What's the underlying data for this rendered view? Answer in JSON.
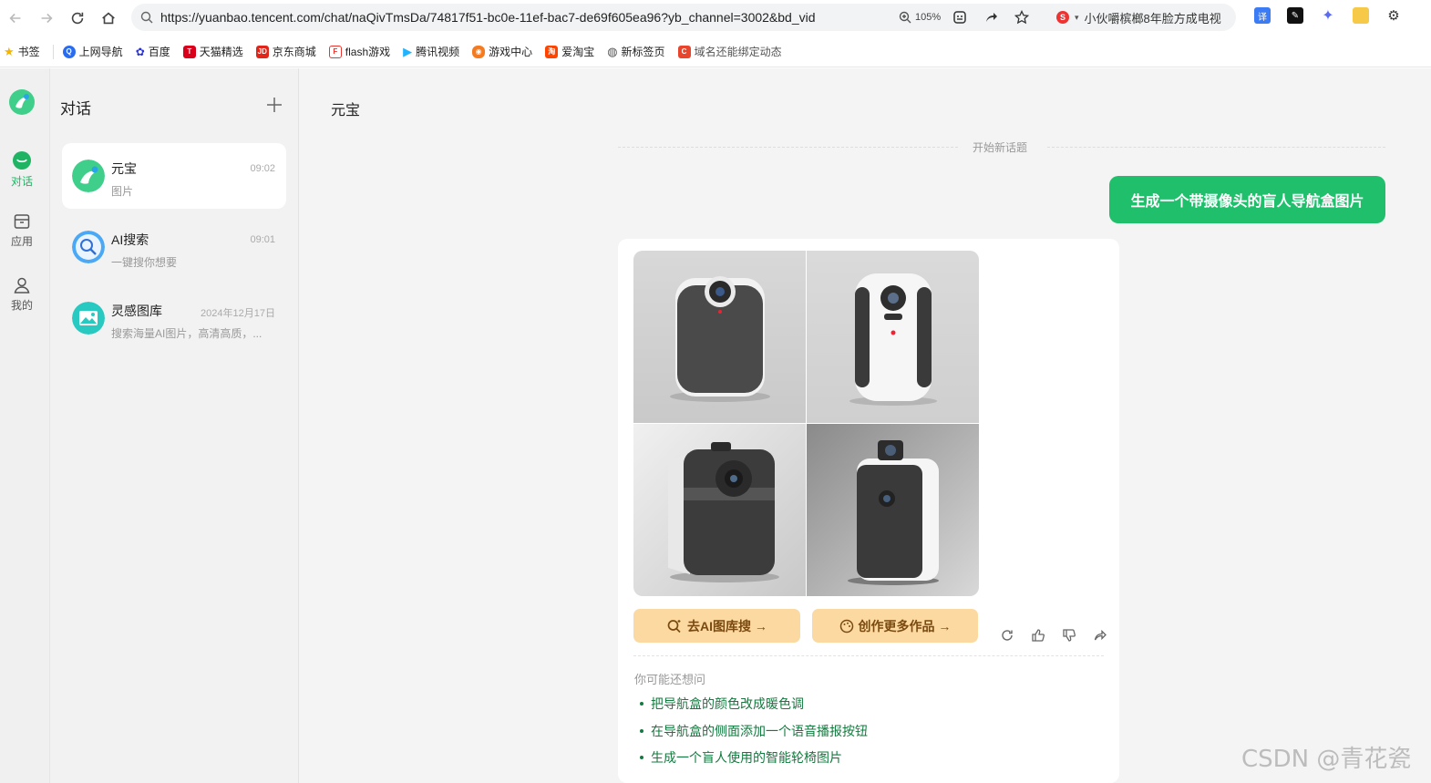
{
  "browser": {
    "url": "https://yuanbao.tencent.com/chat/naQivTmsDa/74817f51-bc0e-11ef-bac7-de69f605ea96?yb_channel=3002&bd_vid",
    "zoom": "105%",
    "search_suggestion": "小伙嚼槟榔8年脸方成电视"
  },
  "bookmarks": [
    {
      "label": "书签",
      "icon": "star-icon",
      "color": "#f5b400"
    },
    {
      "label": "上网导航",
      "icon": "q-icon",
      "color": "#2a6cf0"
    },
    {
      "label": "百度",
      "icon": "baidu-paw-icon",
      "color": "#2932e1"
    },
    {
      "label": "天猫精选",
      "icon": "tmall-icon",
      "color": "#d8001b"
    },
    {
      "label": "京东商城",
      "icon": "jd-icon",
      "color": "#e1251b"
    },
    {
      "label": "flash游戏",
      "icon": "flash-icon",
      "color": "#e8352e"
    },
    {
      "label": "腾讯视频",
      "icon": "tencent-video-icon",
      "color": "#1fb4ff"
    },
    {
      "label": "游戏中心",
      "icon": "gamepad-icon",
      "color": "#f57b20"
    },
    {
      "label": "爱淘宝",
      "icon": "taobao-icon",
      "color": "#ff4400"
    },
    {
      "label": "新标签页",
      "icon": "globe-icon",
      "color": "#555555"
    },
    {
      "label": "域名还能绑定动态",
      "icon": "c-icon",
      "color": "#e8452c"
    }
  ],
  "rail": {
    "items": [
      {
        "label": "对话",
        "icon": "chat-icon",
        "active": true
      },
      {
        "label": "应用",
        "icon": "box-icon",
        "active": false
      },
      {
        "label": "我的",
        "icon": "user-icon",
        "active": false
      }
    ]
  },
  "sidebar": {
    "title": "对话",
    "conversations": [
      {
        "title": "元宝",
        "time": "09:02",
        "subtitle": "图片",
        "active": true
      },
      {
        "title": "AI搜索",
        "time": "09:01",
        "subtitle": "一键搜你想要",
        "active": false
      },
      {
        "title": "灵感图库",
        "time": "2024年12月17日",
        "subtitle": "搜索海量AI图片，高清高质，...",
        "active": false
      }
    ]
  },
  "chat": {
    "title": "元宝",
    "divider_text": "开始新话题",
    "user_message": "生成一个带摄像头的盲人导航盒图片",
    "buttons": {
      "gallery": "去AI图库搜 →",
      "create_more": "创作更多作品 →"
    },
    "suggest_head": "你可能还想问",
    "suggestions": [
      "把导航盒的颜色改成暖色调",
      "在导航盒的侧面添加一个语音播报按钮",
      "生成一个盲人使用的智能轮椅图片"
    ]
  },
  "colors": {
    "accent_green": "#1fbf6b",
    "link_green": "#147a3f",
    "pill_bg": "#fbd9a1"
  },
  "watermark": "CSDN @青花瓷"
}
